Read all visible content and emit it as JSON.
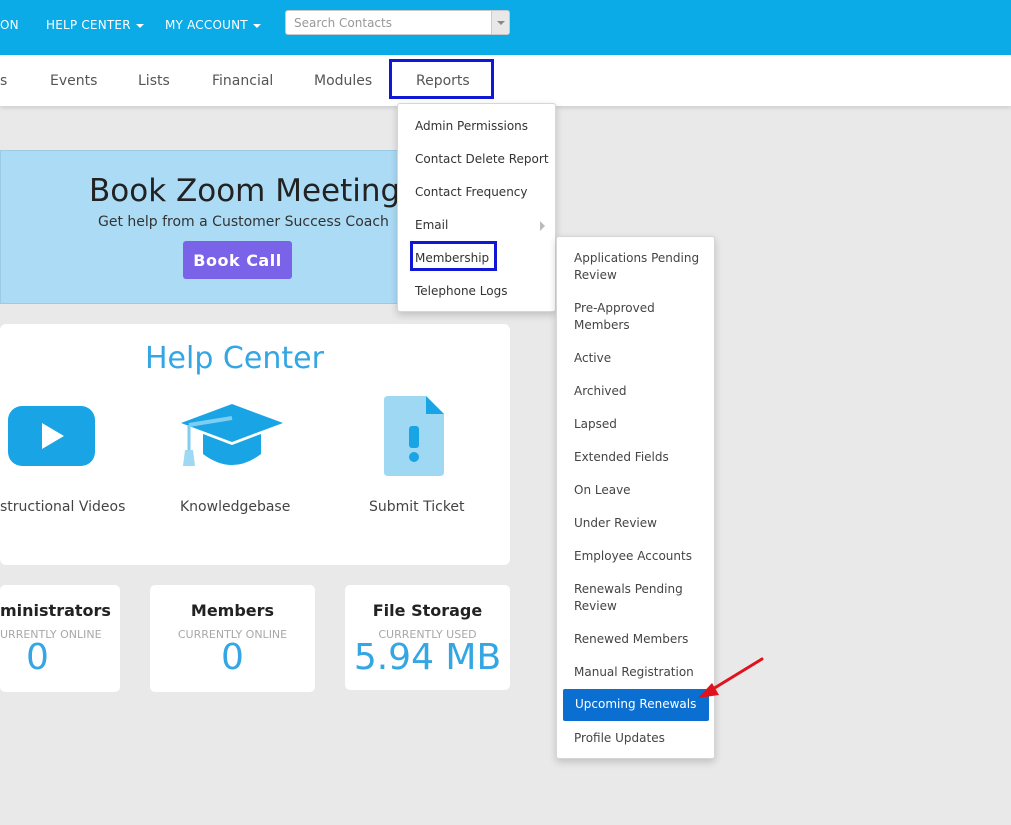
{
  "topnav": {
    "partial_item": "ON",
    "help_center": "HELP CENTER",
    "my_account": "MY ACCOUNT",
    "search_placeholder": "Search Contacts"
  },
  "subnav": {
    "partial_item": "s",
    "events": "Events",
    "lists": "Lists",
    "financial": "Financial",
    "modules": "Modules",
    "reports": "Reports"
  },
  "reports_menu": [
    "Admin Permissions",
    "Contact Delete Report",
    "Contact Frequency",
    "Email",
    "Membership",
    "Telephone Logs"
  ],
  "membership_menu": [
    "Applications Pending Review",
    "Pre-Approved Members",
    "Active",
    "Archived",
    "Lapsed",
    "Extended Fields",
    "On Leave",
    "Under Review",
    "Employee Accounts",
    "Renewals Pending Review",
    "Renewed Members",
    "Manual Registration",
    "Upcoming Renewals",
    "Profile Updates"
  ],
  "zoom": {
    "title": "Book Zoom Meeting",
    "subtitle": "Get help from a Customer Success Coach",
    "button": "Book Call"
  },
  "help_center": {
    "title": "Help Center",
    "videos_label": "structional Videos",
    "kb_label": "Knowledgebase",
    "ticket_label": "Submit Ticket"
  },
  "stats": {
    "admins": {
      "title": "ministrators",
      "sub": "URRENTLY ONLINE",
      "value": "0"
    },
    "members": {
      "title": "Members",
      "sub": "CURRENTLY ONLINE",
      "value": "0"
    },
    "storage": {
      "title": "File Storage",
      "sub": "CURRENTLY USED",
      "value": "5.94 MB"
    }
  },
  "colors": {
    "topbar": "#0babe7",
    "highlight": "#1118d4",
    "active_item": "#0b6ed1",
    "button": "#7a63e9",
    "accent": "#33a6e3",
    "annotation_arrow": "#e0121b"
  }
}
